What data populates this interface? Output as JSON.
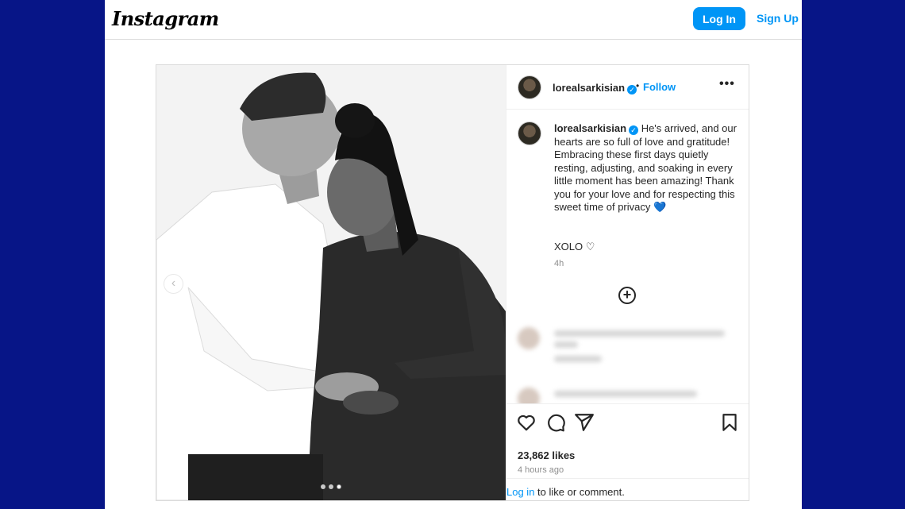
{
  "topbar": {
    "logo": "Instagram",
    "login_label": "Log In",
    "signup_label": "Sign Up"
  },
  "post": {
    "carousel": {
      "total": 3,
      "active_index": 2
    },
    "header": {
      "username": "lorealsarkisian",
      "separator": "•",
      "follow_label": "Follow",
      "more_label": "•••"
    },
    "caption": {
      "username": "lorealsarkisian",
      "text": "He's arrived, and our hearts are so full of love and gratitude! Embracing these first days quietly resting, adjusting, and soaking in every little moment has been amazing! Thank you for your love and for respecting this sweet time of privacy",
      "emoji": "💙",
      "signoff": "XOLO",
      "signoff_emoji": "♡",
      "age": "4h"
    },
    "actions": {
      "likes": "23,862 likes",
      "timestamp": "4 hours ago",
      "login_link": "Log in",
      "login_suffix": " to like or comment."
    }
  },
  "colors": {
    "background": "#071587",
    "accent": "#0095f6",
    "text": "#262626",
    "muted": "#8e8e8e"
  },
  "icons": [
    "verified-badge-icon",
    "heart-icon",
    "comment-icon",
    "share-icon",
    "bookmark-icon",
    "add-comment-icon",
    "chevron-left-icon",
    "more-options-icon"
  ]
}
